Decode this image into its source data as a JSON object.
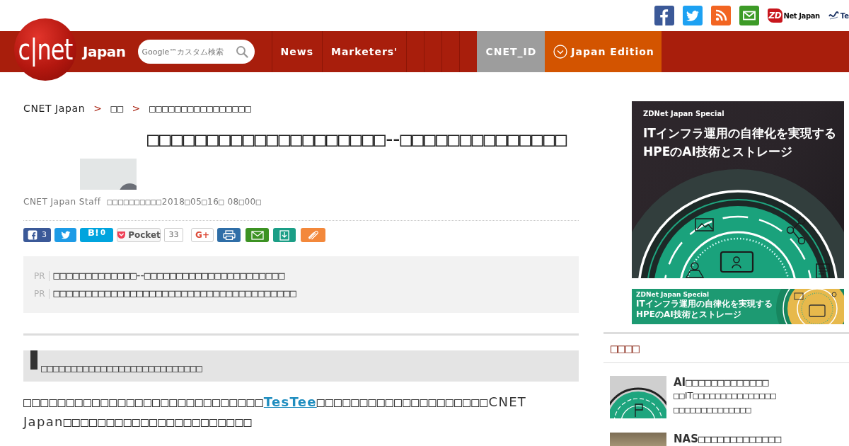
{
  "top_bar": {
    "partners": [
      {
        "kind": "badge",
        "badge": "ZD",
        "text": "Net Japan"
      },
      {
        "kind": "swirl",
        "text": "Te"
      }
    ]
  },
  "header": {
    "logo": "c|net",
    "wordmark": "Japan",
    "search": {
      "placeholder": "Google™カスタム検索"
    },
    "nav": [
      {
        "kind": "link",
        "label": "News"
      },
      {
        "kind": "link",
        "label": "Marketers'"
      },
      {
        "kind": "blank"
      },
      {
        "kind": "blank"
      },
      {
        "kind": "blank"
      },
      {
        "kind": "blank"
      },
      {
        "kind": "account",
        "label": "CNET_ID"
      },
      {
        "kind": "edition",
        "label": "Japan Edition"
      }
    ]
  },
  "breadcrumb": {
    "separator": ">",
    "items": [
      "CNET Japan",
      "□□",
      "□□□□□□□□□□□□□□□□"
    ]
  },
  "article": {
    "title": "□□□□□□□□□□□□□□□□□□□□--□□□□□□□□□□□□□□",
    "byline": {
      "author": "CNET Japan Staff",
      "date": "□□□□□□□□□□2018□05□16□ 08□00□"
    },
    "share": [
      {
        "kind": "facebook",
        "count": "3"
      },
      {
        "kind": "twitter"
      },
      {
        "kind": "hatena",
        "label": "B!",
        "count": "0"
      },
      {
        "kind": "pocket",
        "label": "Pocket",
        "count": "33"
      },
      {
        "kind": "gplus",
        "label": "G+"
      },
      {
        "kind": "print"
      },
      {
        "kind": "mail"
      },
      {
        "kind": "download"
      },
      {
        "kind": "clip"
      }
    ],
    "pr": [
      {
        "tag": "PR",
        "text": "□□□□□□□□□□□□□--□□□□□□□□□□□□□□□□□□□□□□"
      },
      {
        "tag": "PR",
        "text": "□□□□□□□□□□□□□□□□□□□□□□□□□□□□□□□□□□□□□□"
      }
    ],
    "section_heading": "□□□□□□□□□□□□□□□□□□□□□□□□□□□",
    "body": {
      "before": "□□□□□□□□□□□□□□□□□□□□□□□□□□□□",
      "link": "TesTee",
      "after": "□□□□□□□□□□□□□□□□□□□□CNET Japan□□□□□□□□□□□□□□□□□□□□□□"
    }
  },
  "sidebar": {
    "banners": [
      {
        "kind": "square",
        "brand": "ZDNet Japan Special",
        "lines": [
          "ITインフラ運用の自律化を実現する",
          "HPEのAI技術とストレージ"
        ]
      },
      {
        "kind": "wide",
        "brand": "ZDNet Japan Special",
        "lines": [
          "ITインフラ運用の自律化を実現する",
          "HPEのAI技術とストレージ"
        ]
      }
    ],
    "section_title": "□□□□",
    "items": [
      {
        "kind": "illustration",
        "title": "AI□□□□□□□□□□□□□",
        "lines": [
          "□□IT□□□□□□□□□□□□□□□",
          "□□□□□□□□□□□□□□"
        ]
      },
      {
        "kind": "photo",
        "title": "NAS□□□□□□□□□□□□□"
      }
    ]
  }
}
